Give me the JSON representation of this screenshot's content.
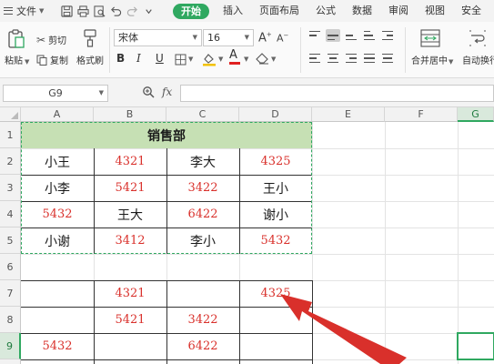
{
  "menu": {
    "file_label": "文件",
    "tabs": [
      "开始",
      "插入",
      "页面布局",
      "公式",
      "数据",
      "审阅",
      "视图",
      "安全"
    ],
    "active_tab_index": 0
  },
  "ribbon": {
    "paste": "粘贴",
    "cut": "剪切",
    "copy": "复制",
    "format_painter": "格式刷",
    "font_name": "宋体",
    "font_size": "16",
    "bold": "B",
    "italic": "I",
    "underline": "U",
    "merge_center": "合并居中",
    "auto_wrap": "自动换行"
  },
  "formula_bar": {
    "name_box": "G9",
    "fx": "fx",
    "formula": ""
  },
  "sheet": {
    "columns": [
      "A",
      "B",
      "C",
      "D",
      "E",
      "F",
      "G"
    ],
    "rows": [
      "1",
      "2",
      "3",
      "4",
      "5",
      "6",
      "7",
      "8",
      "9"
    ],
    "selected_column": "G",
    "selected_row": "9",
    "title": "销售部",
    "cells": {
      "A2": "小王",
      "B2": "4321",
      "C2": "李大",
      "D2": "4325",
      "A3": "小李",
      "B3": "5421",
      "C3": "3422",
      "D3": "王小",
      "A4": "5432",
      "B4": "王大",
      "C4": "6422",
      "D4": "谢小",
      "A5": "小谢",
      "B5": "3412",
      "C5": "李小",
      "D5": "5432",
      "B7": "4321",
      "D7": "4325",
      "B8": "5421",
      "C8": "3422",
      "A9": "5432",
      "C9": "6422"
    }
  },
  "colors": {
    "accent": "#2fa860",
    "title_fill": "#c6e0b4",
    "number_red": "#d9302b",
    "arrow_red": "#d9302b"
  }
}
